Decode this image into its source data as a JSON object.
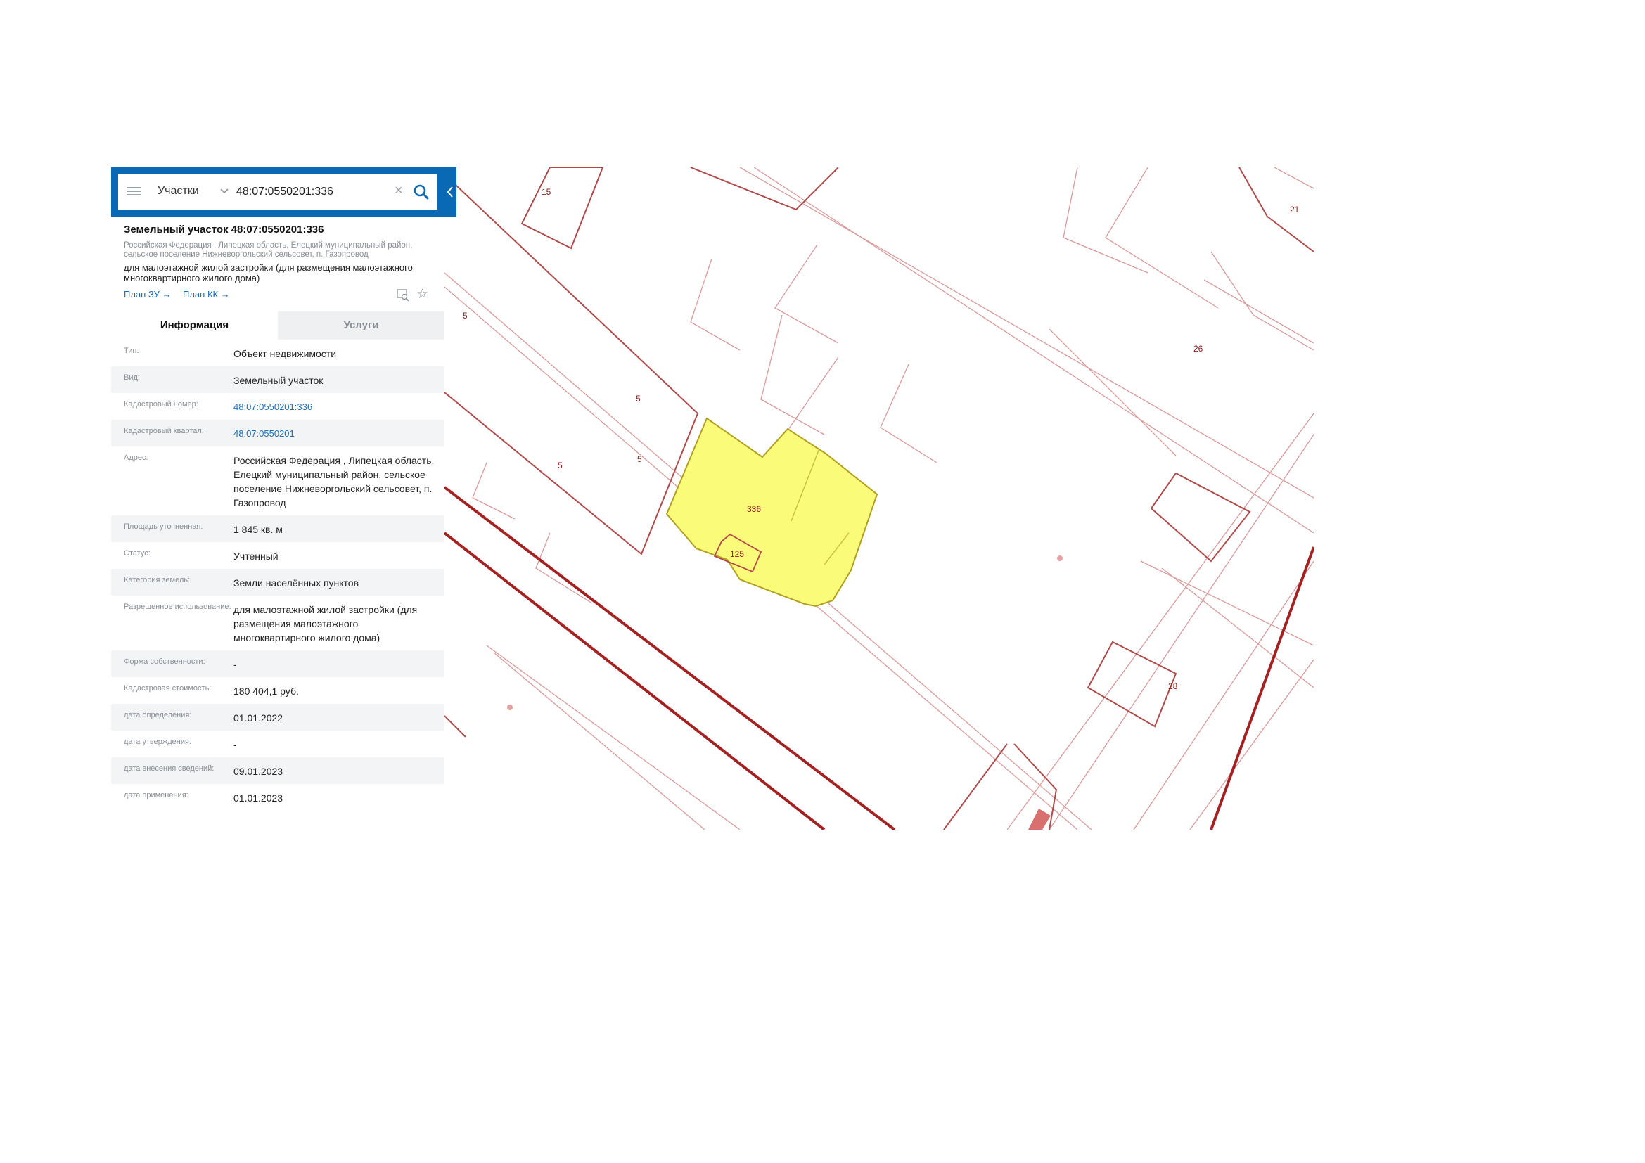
{
  "search": {
    "type": "Участки",
    "value": "48:07:0550201:336"
  },
  "parcel": {
    "title": "Земельный участок 48:07:0550201:336",
    "address": "Российская Федерация , Липецкая область, Елецкий муниципальный район, сельское поселение Нижневоргольский сельсовет, п. Газопровод",
    "purpose": "для малоэтажной жилой застройки (для размещения малоэтажного многоквартирного жилого дома)",
    "links": {
      "plan_zu": "План ЗУ →",
      "plan_kk": "План КК →"
    }
  },
  "tabs": [
    "Информация",
    "Услуги"
  ],
  "info_rows": [
    {
      "label": "Тип:",
      "value": "Объект недвижимости"
    },
    {
      "label": "Вид:",
      "value": "Земельный участок"
    },
    {
      "label": "Кадастровый номер:",
      "value": "48:07:0550201:336"
    },
    {
      "label": "Кадастровый квартал:",
      "value": "48:07:0550201"
    },
    {
      "label": "Адрес:",
      "value": "Российская Федерация , Липецкая область, Елецкий муниципальный район, сельское поселение Нижневоргольский сельсовет, п. Газопровод"
    },
    {
      "label": "Площадь уточненная:",
      "value": "1 845 кв. м"
    },
    {
      "label": "Статус:",
      "value": "Учтенный"
    },
    {
      "label": "Категория земель:",
      "value": "Земли населённых пунктов"
    },
    {
      "label": "Разрешенное использование:",
      "value": "для малоэтажной жилой застройки (для размещения малоэтажного многоквартирного жилого дома)"
    },
    {
      "label": "Форма собственности:",
      "value": "-"
    },
    {
      "label": "Кадастровая стоимость:",
      "value": "180 404,1 руб."
    },
    {
      "label": "дата определения:",
      "value": "01.01.2022"
    },
    {
      "label": "дата утверждения:",
      "value": "-"
    },
    {
      "label": "дата внесения сведений:",
      "value": "09.01.2023"
    },
    {
      "label": "дата применения:",
      "value": "01.01.2023"
    }
  ],
  "map": {
    "labels": [
      "15",
      "21",
      "26",
      "5",
      "5",
      "5",
      "5",
      "336",
      "125",
      "28"
    ],
    "colors": {
      "boundary": "#b04a4a",
      "boundary_thin": "#d99a9a",
      "selected_fill": "#fbfb7a",
      "selected_stroke": "#b0a020"
    }
  },
  "colors": {
    "header": "#0a69b4",
    "link": "#1d6fb8"
  }
}
